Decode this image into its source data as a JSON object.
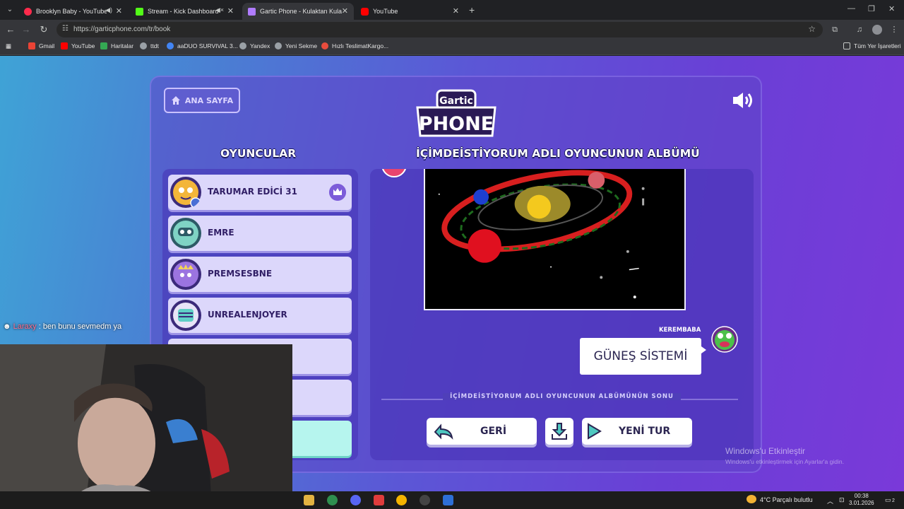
{
  "browser": {
    "tabs": [
      {
        "title": "Brooklyn Baby - YouTube Music",
        "active": false,
        "favicon_color": "#ff2b4c",
        "audio": true
      },
      {
        "title": "Stream - Kick Dashboard",
        "active": false,
        "favicon_color": "#53fc18",
        "audio": true
      },
      {
        "title": "Gartic Phone - Kulaktan Kulağa",
        "active": true,
        "favicon_color": "#b07cff",
        "audio": false
      },
      {
        "title": "YouTube",
        "active": false,
        "favicon_color": "#ff0000",
        "audio": false
      }
    ],
    "url": "https://garticphone.com/tr/book",
    "bookmarks": [
      {
        "label": "Gmail",
        "color": "#ea4335"
      },
      {
        "label": "YouTube",
        "color": "#ff0000"
      },
      {
        "label": "Haritalar",
        "color": "#34a853"
      },
      {
        "label": "ttdt",
        "color": "#9aa0a6"
      },
      {
        "label": "aaDUO SURVIVAL 3...",
        "color": "#4285f4"
      },
      {
        "label": "Yandex",
        "color": "#9aa0a6"
      },
      {
        "label": "Yeni Sekme",
        "color": "#9aa0a6"
      },
      {
        "label": "Hızlı TeslimatKargo...",
        "color": "#e84c3d"
      }
    ],
    "all_bookmarks_label": "Tüm Yer İşaretleri"
  },
  "game": {
    "home_label": "ANA SAYFA",
    "logo_small": "Gartic",
    "logo_big": "PHONE",
    "players_title": "OYUNCULAR",
    "album_title": "İÇİMDEİSTİYORUM ADLI OYUNCUNUN ALBÜMÜ",
    "players": [
      {
        "name": "TARUMAR EDİCİ 31",
        "avatar_color": "#f3b63a",
        "host": true
      },
      {
        "name": "EMRE",
        "avatar_color": "#7fd3c4",
        "host": false
      },
      {
        "name": "PREMSESBNE",
        "avatar_color": "#9b74e0",
        "host": false
      },
      {
        "name": "UNREALENJOYER",
        "avatar_color": "#5fcfc6",
        "host": false
      }
    ],
    "guess_author": "KEREMBABA",
    "guess_text": "GÜNEŞ SİSTEMİ",
    "album_end_text": "İÇİMDEİSTİYORUM ADLI OYUNCUNUN ALBÜMÜNÜN SONU",
    "back_label": "GERİ",
    "new_round_label": "YENİ TUR"
  },
  "overlay": {
    "chat_user": "Laraxy",
    "chat_message": ": ben bunu sevmedm ya",
    "watermark_title": "Windows'u Etkinleştir",
    "watermark_sub": "Windows'u etkinleştirmek için Ayarlar'a gidin."
  },
  "taskbar": {
    "weather": "4°C  Parçalı bulutlu",
    "time": "00:38",
    "date": "3.01.2026",
    "notifications": "2"
  }
}
